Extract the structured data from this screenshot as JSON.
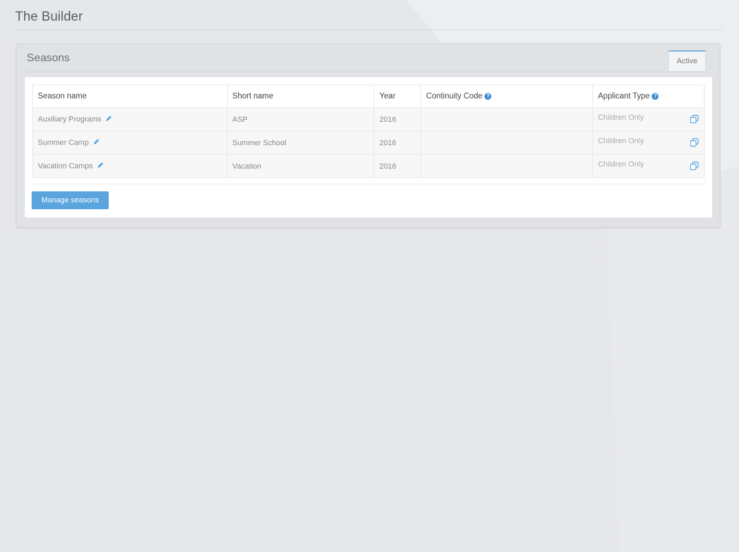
{
  "page": {
    "title": "The Builder"
  },
  "panel": {
    "title": "Seasons",
    "tab_label": "Active"
  },
  "table": {
    "headers": {
      "season_name": "Season name",
      "short_name": "Short name",
      "year": "Year",
      "continuity_code": "Continuity Code",
      "applicant_type": "Applicant Type"
    },
    "rows": [
      {
        "season_name": "Auxiliary Programs",
        "short_name": "ASP",
        "year": "2016",
        "continuity_code": "",
        "applicant_type": "Children Only"
      },
      {
        "season_name": "Summer Camp",
        "short_name": "Summer School",
        "year": "2016",
        "continuity_code": "",
        "applicant_type": "Children Only"
      },
      {
        "season_name": "Vacation Camps",
        "short_name": "Vacation",
        "year": "2016",
        "continuity_code": "",
        "applicant_type": "Children Only"
      }
    ]
  },
  "actions": {
    "manage_label": "Manage seasons"
  },
  "icons": {
    "help": "help-circle-icon",
    "edit": "pencil-icon",
    "copy": "copy-icon"
  },
  "colors": {
    "accent": "#5aa5de",
    "help": "#3a8ad0",
    "background": "#e6e7ea"
  }
}
